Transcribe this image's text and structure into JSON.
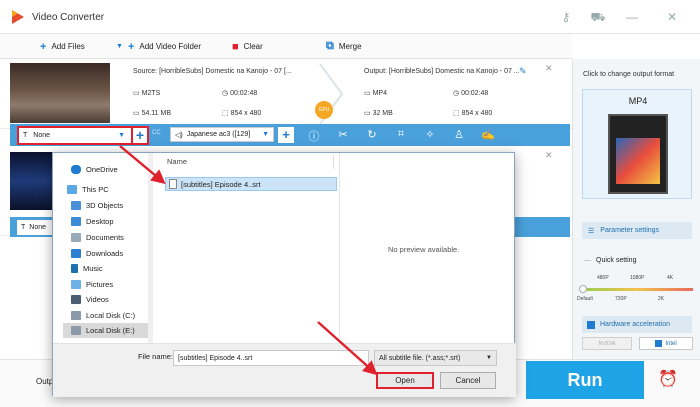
{
  "app": {
    "title": "Video Converter"
  },
  "toolbar": {
    "add_files": "Add Files",
    "add_folder": "Add Video Folder",
    "clear": "Clear",
    "merge": "Merge"
  },
  "files": [
    {
      "source": "Source: [HorribleSubs] Domestic na Kanojo - 07 [...",
      "output": "Output: [HorribleSubs] Domestic na Kanojo - 07 ...",
      "src_format": "M2TS",
      "src_duration": "00:02:48",
      "src_size": "54.11 MB",
      "src_res": "854 x 480",
      "out_format": "MP4",
      "out_duration": "00:02:48",
      "out_size": "32 MB",
      "out_res": "854 x 480"
    }
  ],
  "gpu_label": "GPU",
  "subtitle_select": "None",
  "subtitle_select_2": "None",
  "audio_select": "Japanese ac3 ([129]",
  "cc_label": "CC",
  "side": {
    "change_format": "Click to change output format",
    "format": "MP4",
    "param_settings": "Parameter settings",
    "quick_setting": "Quick setting",
    "res_top": [
      "480P",
      "1080P",
      "4K"
    ],
    "res_bottom": [
      "Default",
      "720P",
      "2K"
    ],
    "hw_accel": "Hardware acceleration",
    "nvidia": "NVIDIA",
    "intel": "Intel"
  },
  "output_label": "Outp",
  "run": "Run",
  "dialog": {
    "nav": [
      "OneDrive",
      "This PC",
      "3D Objects",
      "Desktop",
      "Documents",
      "Downloads",
      "Music",
      "Pictures",
      "Videos",
      "Local Disk (C:)",
      "Local Disk (E:)"
    ],
    "name_header": "Name",
    "selected_file": "[subtitles] Episode 4..srt",
    "preview": "No preview available.",
    "file_name_label": "File name:",
    "file_name_value": "[subtitles] Episode 4..srt",
    "file_type": "All subtitle file. (*.ass;*.srt)",
    "open": "Open",
    "cancel": "Cancel"
  },
  "colors": {
    "accent": "#4aa0db",
    "run": "#1ea3e6",
    "highlight": "#e0212e"
  }
}
